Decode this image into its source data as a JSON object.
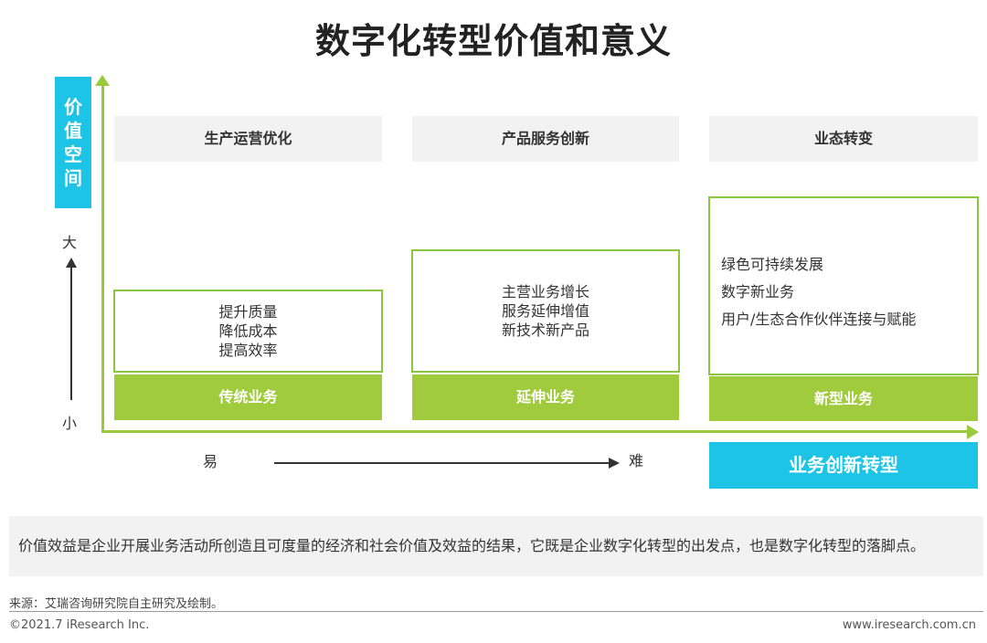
{
  "title": "数字化转型价值和意义",
  "axis": {
    "y_label_chars": [
      "价",
      "值",
      "空",
      "间"
    ],
    "y_high": "大",
    "y_low": "小",
    "x_low": "易",
    "x_high": "难"
  },
  "columns": [
    {
      "header": "生产运营优化",
      "items": [
        "提升质量",
        "降低成本",
        "提高效率"
      ],
      "bar": "传统业务"
    },
    {
      "header": "产品服务创新",
      "items": [
        "主营业务增长",
        "服务延伸增值",
        "新技术新产品"
      ],
      "bar": "延伸业务"
    },
    {
      "header": "业态转变",
      "items": [
        "绿色可持续发展",
        "数字新业务",
        "用户/生态合作伙伴连接与赋能"
      ],
      "bar": "新型业务"
    }
  ],
  "transform_label": "业务创新转型",
  "note": "价值效益是企业开展业务活动所创造且可度量的经济和社会价值及效益的结果，它既是企业数字化转型的出发点，也是数字化转型的落脚点。",
  "source": "来源：艾瑞咨询研究院自主研究及绘制。",
  "copyright": "©2021.7 iResearch Inc.",
  "website": "www.iresearch.com.cn",
  "colors": {
    "accent_green": "#9fcb3c",
    "accent_cyan": "#1ec4e6"
  }
}
